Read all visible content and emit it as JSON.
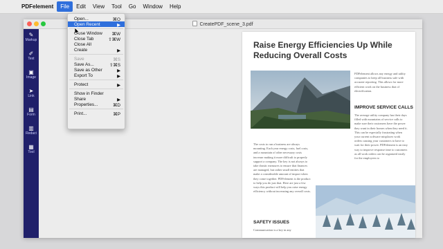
{
  "menubar": {
    "app": "PDFelement",
    "items": [
      "File",
      "Edit",
      "View",
      "Tool",
      "Go",
      "Window",
      "Help"
    ]
  },
  "window": {
    "doc_title": "CreatePDF_scene_3.pdf"
  },
  "sidebar": {
    "tools": [
      {
        "label": "Markup",
        "icon": "markup-icon",
        "glyph": "✎"
      },
      {
        "label": "Text",
        "icon": "text-icon",
        "glyph": "✐"
      },
      {
        "label": "Image",
        "icon": "image-icon",
        "glyph": "▣"
      },
      {
        "label": "Link",
        "icon": "link-icon",
        "glyph": "➤"
      },
      {
        "label": "Form",
        "icon": "form-icon",
        "glyph": "▤"
      },
      {
        "label": "Redact",
        "icon": "redact-icon",
        "glyph": "▥"
      },
      {
        "label": "Tool",
        "icon": "tool-icon",
        "glyph": "▦"
      }
    ]
  },
  "file_menu": {
    "items": [
      {
        "label": "Open...",
        "shortcut": "⌘O"
      },
      {
        "label": "Open Recent",
        "shortcut": "▶"
      },
      {
        "label": "Close Window",
        "shortcut": "⌘W"
      },
      {
        "label": "Close Tab",
        "shortcut": "⇧⌘W"
      },
      {
        "label": "Close All",
        "shortcut": ""
      },
      {
        "label": "Create",
        "shortcut": "▶"
      },
      {
        "label": "Save",
        "shortcut": "⌘S"
      },
      {
        "label": "Save As...",
        "shortcut": "⇧⌘S"
      },
      {
        "label": "Save as Other",
        "shortcut": "▶"
      },
      {
        "label": "Export To",
        "shortcut": "▶"
      },
      {
        "label": "Protect",
        "shortcut": "▶"
      },
      {
        "label": "Show in Finder",
        "shortcut": ""
      },
      {
        "label": "Share",
        "shortcut": "▶"
      },
      {
        "label": "Properties...",
        "shortcut": "⌘D"
      },
      {
        "label": "Print...",
        "shortcut": "⌘P"
      }
    ]
  },
  "document": {
    "headline": "Raise Energy Efficiencies Up While Reducing Overall Costs",
    "intro": "PDFelement allows any energy and utility companies to keep all business safe with accurate reporting. This allows for more efficient work on the business that of electrification.",
    "subhead1": "IMPROVE SERVICE CALLS",
    "service_text": "The average utility company has their days filled with mountains of service calls to make sure their customers have the power they want in their homes when they need it. This can be especially frustrating when your current software misplaces work orders causing your customers to have to wait for their power. PDFelement is an easy way to improve response time to customers as all work orders can be organized easily for the employees to",
    "left_text": "The costs to run a business are always mounting. Each year energy costs, fuel costs, and a mountain of other necessary costs increase making it more difficult to properly support a company. The key is not always to take drastic measures to ensure that finances are managed, but rather small entities that make a considerable amount of impact when they come together. PDFelement is the product to help you do just that. Here are just a few ways this product will help you raise energy efficiency without increasing any overall costs.",
    "subhead2": "SAFETY ISSUES",
    "safety_text": "Communication is a key in any"
  }
}
